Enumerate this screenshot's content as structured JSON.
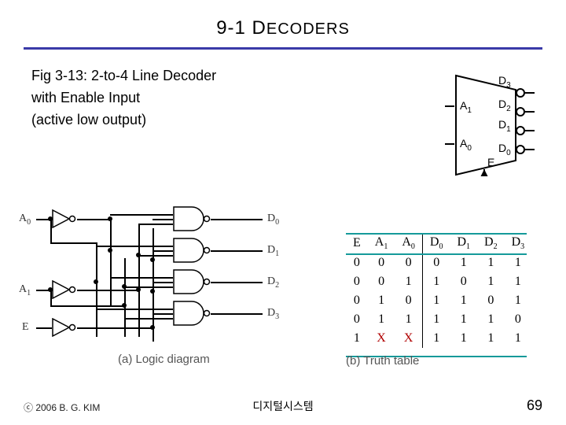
{
  "title_prefix": "9-1  D",
  "title_smallcaps": "ECODERS",
  "desc_line1": "Fig 3-13: 2-to-4 Line Decoder",
  "desc_line2": "with Enable Input",
  "desc_line3": "(active low output)",
  "decoder_symbol": {
    "A1": "A",
    "A1_sub": "1",
    "A0": "A",
    "A0_sub": "0",
    "E": "E",
    "D3": "D",
    "D3_sub": "3",
    "D2": "D",
    "D2_sub": "2",
    "D1": "D",
    "D1_sub": "1",
    "D0": "D",
    "D0_sub": "0"
  },
  "logic_labels": {
    "A0": "A",
    "A0_sub": "0",
    "A1": "A",
    "A1_sub": "1",
    "E": "E",
    "D0": "D",
    "D0_sub": "0",
    "D1": "D",
    "D1_sub": "1",
    "D2": "D",
    "D2_sub": "2",
    "D3": "D",
    "D3_sub": "3"
  },
  "caption_a": "(a) Logic diagram",
  "caption_b": "(b) Truth table",
  "truth_headers": {
    "E": "E",
    "A1": "A",
    "A1_sub": "1",
    "A0": "A",
    "A0_sub": "0",
    "D0": "D",
    "D0_sub": "0",
    "D1": "D",
    "D1_sub": "1",
    "D2": "D",
    "D2_sub": "2",
    "D3": "D",
    "D3_sub": "3"
  },
  "truth_rows": [
    [
      "0",
      "0",
      "0",
      "0",
      "1",
      "1",
      "1"
    ],
    [
      "0",
      "0",
      "1",
      "1",
      "0",
      "1",
      "1"
    ],
    [
      "0",
      "1",
      "0",
      "1",
      "1",
      "0",
      "1"
    ],
    [
      "0",
      "1",
      "1",
      "1",
      "1",
      "1",
      "0"
    ],
    [
      "1",
      "X",
      "X",
      "1",
      "1",
      "1",
      "1"
    ]
  ],
  "footer_left": "ⓒ 2006  B. G. KIM",
  "footer_mid": "디지털시스템",
  "footer_right": "69"
}
